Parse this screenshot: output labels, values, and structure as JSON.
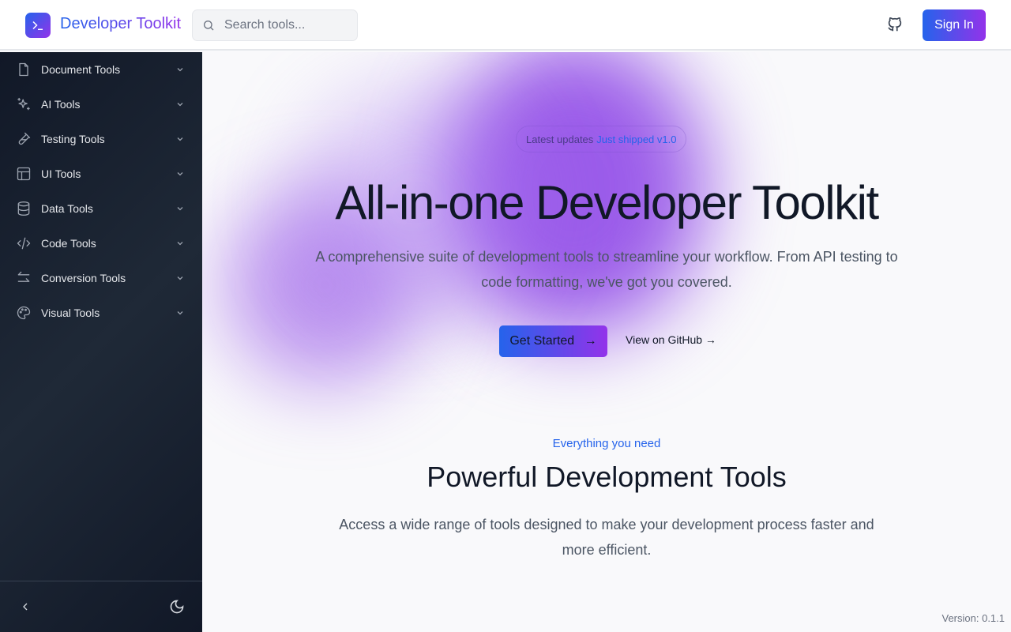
{
  "header": {
    "brand": "Developer Toolkit",
    "search_placeholder": "Search tools...",
    "sign_in": "Sign In"
  },
  "sidebar": {
    "items": [
      {
        "label": "Document Tools",
        "icon": "file-icon"
      },
      {
        "label": "AI Tools",
        "icon": "sparkles-icon"
      },
      {
        "label": "Testing Tools",
        "icon": "test-tube-icon"
      },
      {
        "label": "UI Tools",
        "icon": "layout-icon"
      },
      {
        "label": "Data Tools",
        "icon": "database-icon"
      },
      {
        "label": "Code Tools",
        "icon": "code-icon"
      },
      {
        "label": "Conversion Tools",
        "icon": "arrows-icon"
      },
      {
        "label": "Visual Tools",
        "icon": "palette-icon"
      }
    ]
  },
  "hero": {
    "badge_label": "Latest updates",
    "badge_highlight": "Just shipped v1.0",
    "title": "All-in-one Developer Toolkit",
    "subtitle": "A comprehensive suite of development tools to streamline your workflow. From API testing to code formatting, we've got you covered.",
    "cta": "Get Started",
    "github_link": "View on GitHub →"
  },
  "features": {
    "eyebrow": "Everything you need",
    "title": "Powerful Development Tools",
    "description": "Access a wide range of tools designed to make your development process faster and more efficient."
  },
  "version": "Version: 0.1.1"
}
